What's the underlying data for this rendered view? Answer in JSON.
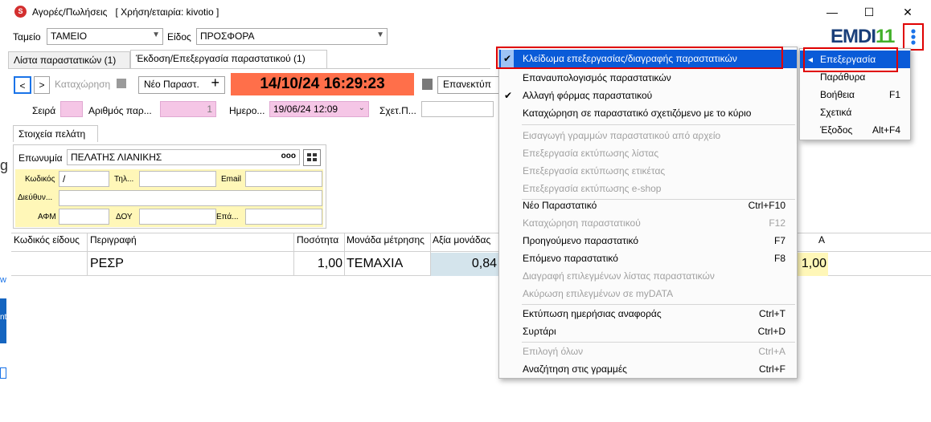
{
  "window": {
    "title": "Αγορές/Πωλήσεις",
    "company": "[ Χρήση/εταιρία: kivotio ]",
    "app_icon_letter": "S",
    "minimize": "—",
    "maximize": "☐",
    "close": "✕"
  },
  "logo": {
    "text_main": "EMDI",
    "text_num": "11",
    "color_main": "#1a3f7a",
    "color_num": "#43b02a"
  },
  "filters": {
    "tameio_label": "Ταμείο",
    "tameio_value": "ΤΑΜΕΙΟ",
    "eidos_label": "Είδος",
    "eidos_value": "ΠΡΟΣΦΟΡΑ"
  },
  "tabs": [
    {
      "label": "Λίστα παραστατικών (1)"
    },
    {
      "label": "Έκδοση/Επεξεργασία παραστατικού (1)"
    }
  ],
  "toolbar": {
    "prev": "<",
    "next": ">",
    "save_label": "Καταχώρηση",
    "new_label": "Νέο Παραστ.",
    "datetime": "14/10/24 16:29:23",
    "reload_label": "Επανεκτύπ"
  },
  "doc": {
    "seira_label": "Σειρά",
    "arithmos_label": "Αριθμός παρ...",
    "arithmos_value": "1",
    "imero_label": "Ημερο...",
    "imero_value": "19/06/24 12:09",
    "sxet_label": "Σχετ.Π..."
  },
  "customer": {
    "tab_label": "Στοιχεία πελάτη",
    "eponymia_label": "Επωνυμία",
    "eponymia_value": "ΠΕΛΑΤΗΣ ΛΙΑΝΙΚΗΣ",
    "more_btn": "ooo",
    "kodikos_label": "Κωδικός",
    "kodikos_value": "/",
    "til_label": "Τηλ...",
    "email_label": "Email",
    "dieuth_label": "Διεύθυν...",
    "afm_label": "ΑΦΜ",
    "doy_label": "ΔΟΥ",
    "epa_label": "Επά..."
  },
  "grid": {
    "headers": [
      "Κωδικός είδους",
      "Περιγραφή",
      "Ποσότητα",
      "Μονάδα μέτρησης",
      "Αξία μονάδας"
    ],
    "row": {
      "perigrafi": "ΡΕΣΡ",
      "posotita": "1,00",
      "monada": "ΤΕΜΑΧΙΑ",
      "axia": "0,84",
      "extra": "1,00",
      "extra_head": "A"
    }
  },
  "left_edge": {
    "g_char": "g",
    "w_char": "w",
    "nt_char": "nt"
  },
  "menu_main": [
    {
      "label": "Κλείδωμα επεξεργασίας/διαγραφής παραστατικών",
      "shortcut": "",
      "checked": true,
      "disabled": false,
      "highlight": true
    },
    {
      "label": "Επαναυπολογισμός παραστατικών",
      "shortcut": "",
      "checked": false,
      "disabled": false
    },
    {
      "label": "Αλλαγή φόρμας παραστατικού",
      "shortcut": "",
      "checked": true,
      "disabled": false
    },
    {
      "label": "Καταχώρηση σε παραστατικό σχετιζόμενο με το κύριο",
      "shortcut": "",
      "checked": false,
      "disabled": false
    },
    {
      "label": "Εισαγωγή γραμμών παραστατικού από αρχείο",
      "shortcut": "",
      "checked": false,
      "disabled": true
    },
    {
      "label": "Επεξεργασία εκτύπωσης λίστας",
      "shortcut": "",
      "checked": false,
      "disabled": true
    },
    {
      "label": "Επεξεργασία εκτύπωσης ετικέτας",
      "shortcut": "",
      "checked": false,
      "disabled": true
    },
    {
      "label": "Επεξεργασία εκτύπωσης e-shop",
      "shortcut": "",
      "checked": false,
      "disabled": true
    },
    {
      "label": "Νέο Παραστατικό",
      "shortcut": "Ctrl+F10",
      "checked": false,
      "disabled": false
    },
    {
      "label": "Καταχώρηση παραστατικού",
      "shortcut": "F12",
      "checked": false,
      "disabled": true
    },
    {
      "label": "Προηγούμενο παραστατικό",
      "shortcut": "F7",
      "checked": false,
      "disabled": false
    },
    {
      "label": "Επόμενο παραστατικό",
      "shortcut": "F8",
      "checked": false,
      "disabled": false
    },
    {
      "label": "Διαγραφή επιλεγμένων λίστας παραστατικών",
      "shortcut": "",
      "checked": false,
      "disabled": true
    },
    {
      "label": "Ακύρωση επιλεγμένων σε myDATA",
      "shortcut": "",
      "checked": false,
      "disabled": true
    },
    {
      "label": "Εκτύπωση ημερήσιας αναφοράς",
      "shortcut": "Ctrl+T",
      "checked": false,
      "disabled": false
    },
    {
      "label": "Συρτάρι",
      "shortcut": "Ctrl+D",
      "checked": false,
      "disabled": false
    },
    {
      "label": "Επιλογή όλων",
      "shortcut": "Ctrl+A",
      "checked": false,
      "disabled": true
    },
    {
      "label": "Αναζήτηση στις γραμμές",
      "shortcut": "Ctrl+F",
      "checked": false,
      "disabled": false
    }
  ],
  "menu_side": [
    {
      "label": "Επεξεργασία",
      "shortcut": "",
      "highlight": true
    },
    {
      "label": "Παράθυρα",
      "shortcut": ""
    },
    {
      "label": "Βοήθεια",
      "shortcut": "F1"
    },
    {
      "label": "Σχετικά",
      "shortcut": ""
    },
    {
      "label": "Έξοδος",
      "shortcut": "Alt+F4"
    }
  ],
  "colors": {
    "highlight": "#0a5bd8",
    "date_bg": "#ff6f4a",
    "accent": "#1a73e8"
  }
}
